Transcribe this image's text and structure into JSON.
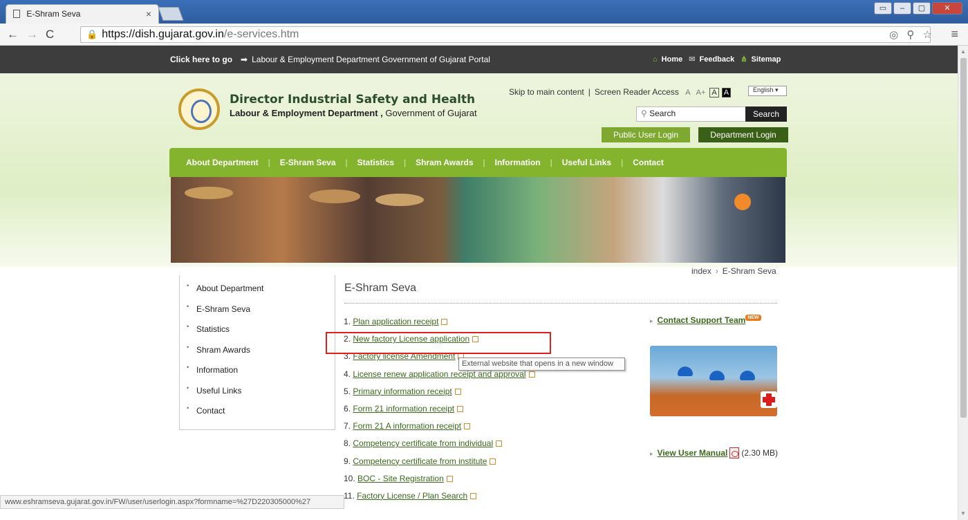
{
  "browser": {
    "tab_title": "E-Shram Seva",
    "tab_close": "×",
    "url_host": "https://dish.gujarat.gov.in",
    "url_path": "/e-services.htm",
    "window_controls": [
      "▭",
      "–",
      "▢",
      "✕"
    ],
    "status_url": "www.eshramseva.gujarat.gov.in/FW/user/userlogin.aspx?formname=%27D220305000%27"
  },
  "topbar": {
    "goto_prefix": "Click here to go",
    "portal_link": "Labour & Employment Department Government of Gujarat Portal",
    "home": "Home",
    "feedback": "Feedback",
    "sitemap": "Sitemap"
  },
  "header": {
    "org_name": "Director Industrial Safety and Health",
    "dept_bold": "Labour & Employment Department ,",
    "dept_rest": " Government of Gujarat",
    "skip_link": "Skip to main content",
    "separator": "|",
    "screen_reader": "Screen Reader Access",
    "font_sizes": [
      "A",
      "A+",
      "A",
      "A"
    ],
    "language": "English",
    "search_placeholder": "Search",
    "search_button": "Search",
    "public_login": "Public User Login",
    "dept_login": "Department Login"
  },
  "nav": {
    "items": [
      "About Department",
      "E-Shram Seva",
      "Statistics",
      "Shram Awards",
      "Information",
      "Useful Links",
      "Contact"
    ],
    "separator": "|"
  },
  "breadcrumb": {
    "home": "index",
    "sep": "›",
    "current": "E-Shram Seva"
  },
  "sidebar": {
    "items": [
      "About Department",
      "E-Shram Seva",
      "Statistics",
      "Shram Awards",
      "Information",
      "Useful Links",
      "Contact"
    ]
  },
  "main": {
    "title": "E-Shram Seva",
    "links": [
      {
        "num": "1.",
        "label": "Plan application receipt"
      },
      {
        "num": "2.",
        "label": "New factory License application"
      },
      {
        "num": "3.",
        "label": "Factory license Amendment"
      },
      {
        "num": "4.",
        "label": "License renew application receipt and approval"
      },
      {
        "num": "5.",
        "label": "Primary information receipt"
      },
      {
        "num": "6.",
        "label": "Form 21 information receipt"
      },
      {
        "num": "7.",
        "label": "Form 21 A information receipt"
      },
      {
        "num": "8.",
        "label": "Competency certificate from individual"
      },
      {
        "num": "9.",
        "label": "Competency certificate from institute"
      },
      {
        "num": "10.",
        "label": "BOC - Site Registration"
      },
      {
        "num": "11.",
        "label": "Factory License / Plan Search"
      }
    ],
    "tooltip": "External website that opens in a new window"
  },
  "right": {
    "support_label": "Contact Support Team",
    "new_badge": "NEW",
    "manual_label": "View User Manual",
    "manual_size": "(2.30 MB)"
  },
  "colors": {
    "nav_green": "#84b42e",
    "dark_green": "#3a5f17",
    "topbar": "#3d3d3d",
    "link_green": "#3a6a1a",
    "highlight_red": "#e21f1f"
  }
}
